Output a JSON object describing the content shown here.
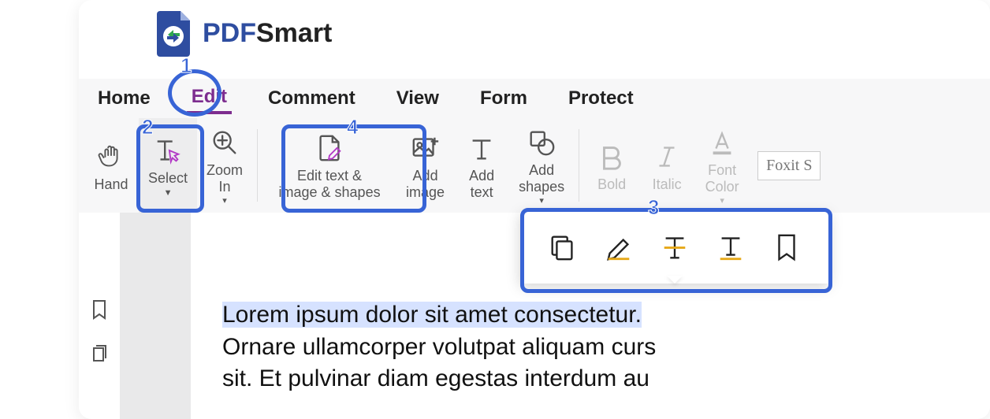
{
  "brand": {
    "name_prefix": "PDF",
    "name_suffix": "Smart"
  },
  "menu": {
    "items": [
      {
        "label": "Home",
        "active": false
      },
      {
        "label": "Edit",
        "active": true
      },
      {
        "label": "Comment",
        "active": false
      },
      {
        "label": "View",
        "active": false
      },
      {
        "label": "Form",
        "active": false
      },
      {
        "label": "Protect",
        "active": false
      }
    ]
  },
  "ribbon": {
    "hand": "Hand",
    "select": "Select",
    "zoom_in": "Zoom\nIn",
    "edit_text_image_shapes_l1": "Edit text &",
    "edit_text_image_shapes_l2": "image & shapes",
    "add_image": "Add\nimage",
    "add_text": "Add\ntext",
    "add_shapes": "Add\nshapes",
    "bold": "Bold",
    "italic": "Italic",
    "font_color": "Font\nColor",
    "font_name": "Foxit S"
  },
  "document": {
    "line1": "Lorem ipsum dolor sit amet consectetur.",
    "line2": "Ornare ullamcorper volutpat aliquam curs",
    "line3": "sit. Et pulvinar diam egestas interdum au"
  },
  "float_tools": {
    "items": [
      "copy-icon",
      "highlight-icon",
      "strikethrough-icon",
      "underline-icon",
      "bookmark-icon"
    ]
  },
  "callouts": {
    "c1": "1",
    "c2": "2",
    "c3": "3",
    "c4": "4"
  }
}
